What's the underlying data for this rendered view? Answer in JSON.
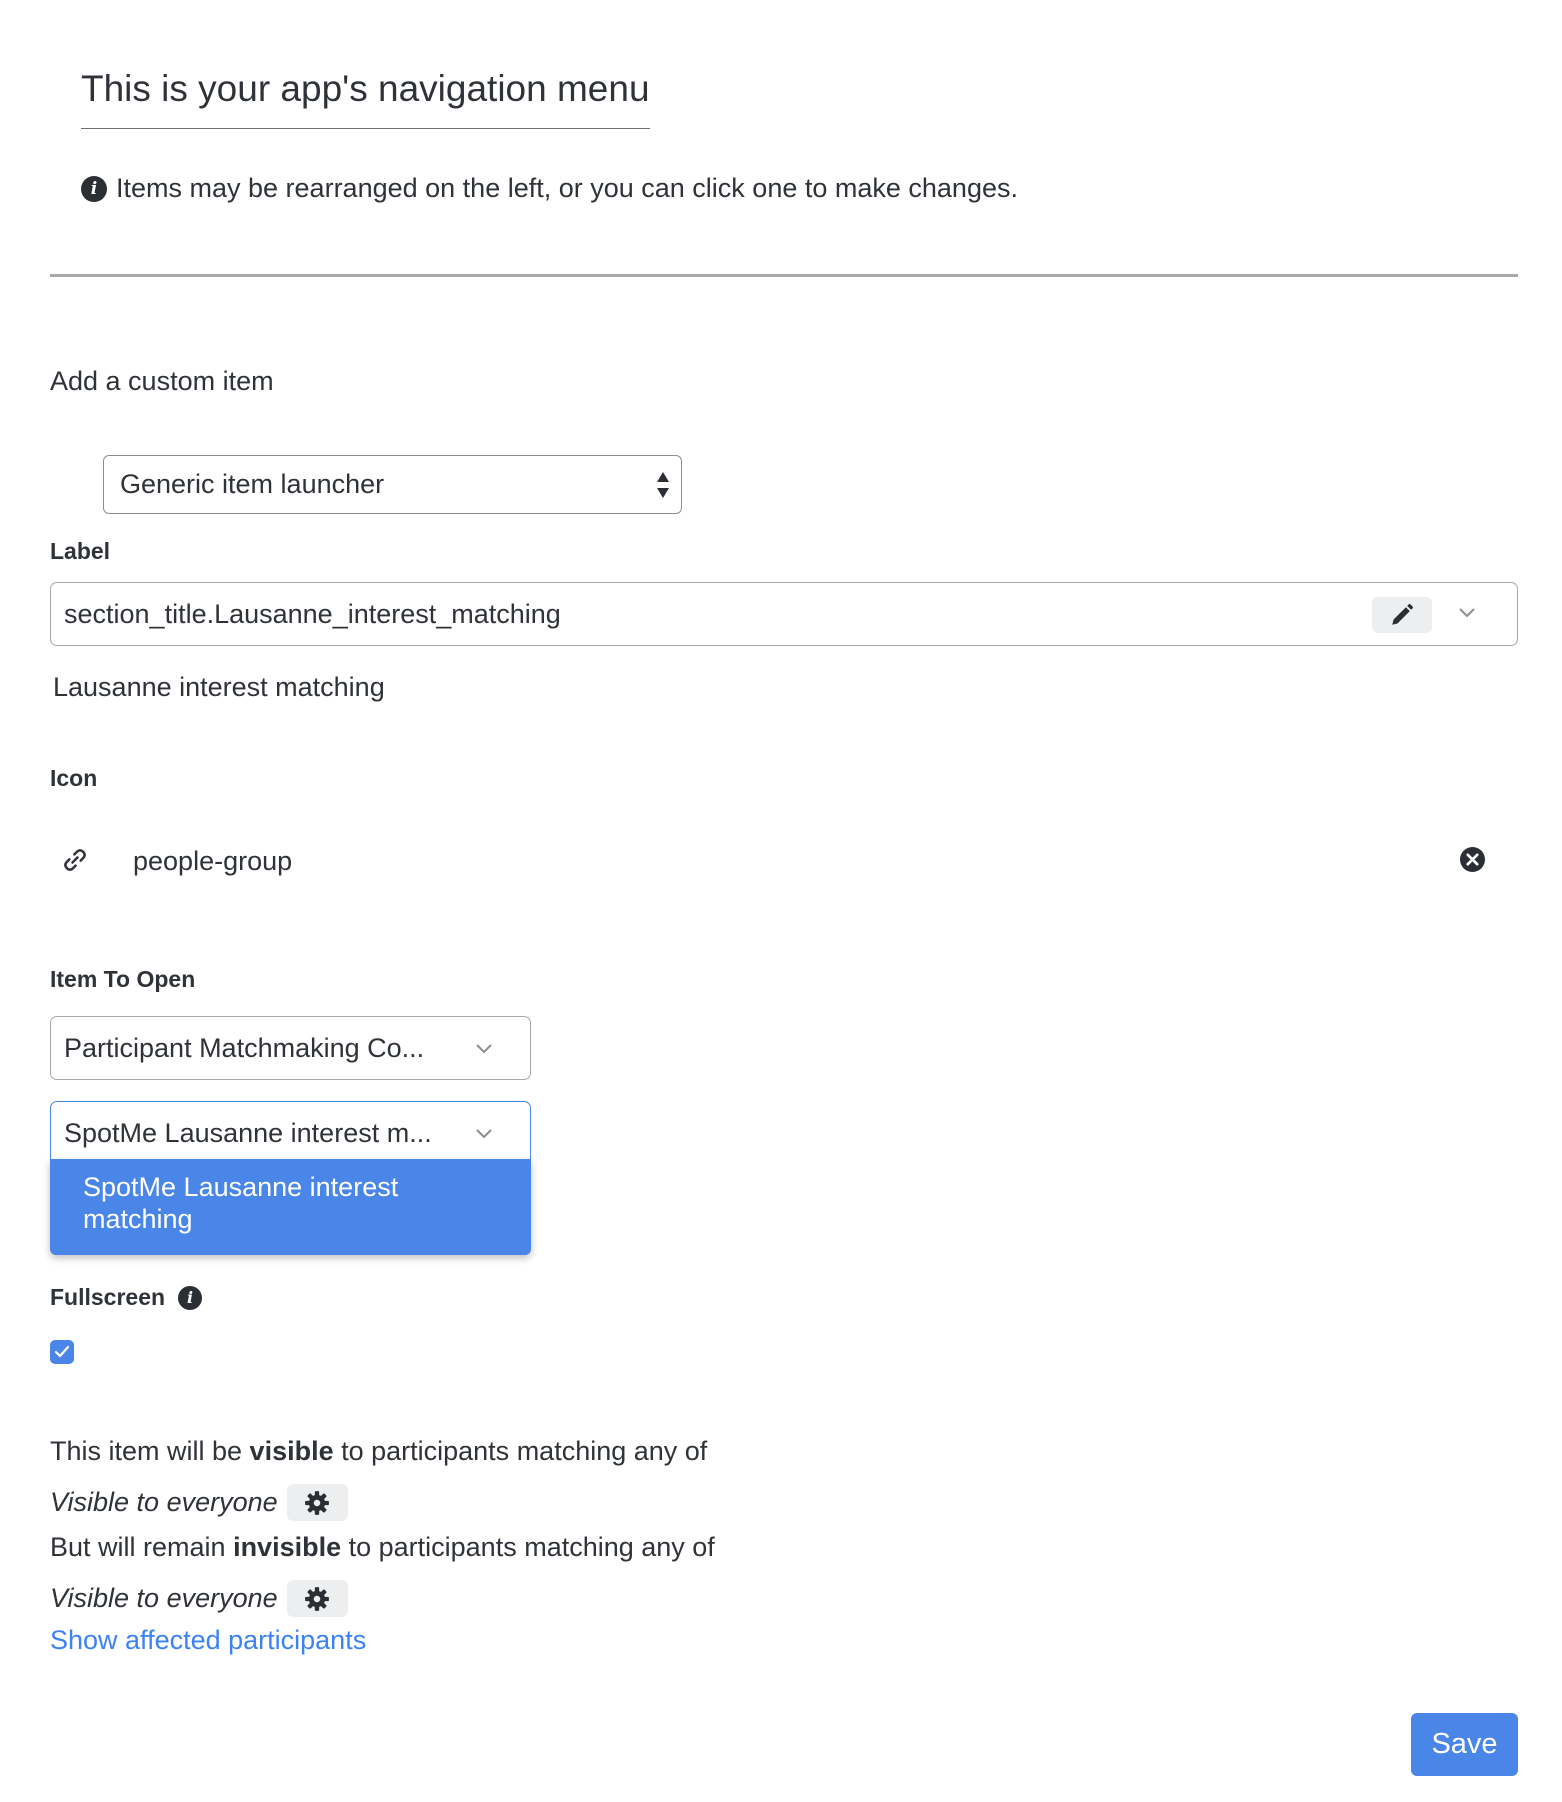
{
  "header": {
    "title": "This is your app's navigation menu",
    "hint": "Items may be rearranged on the left, or you can click one to make changes."
  },
  "custom_item": {
    "section_title": "Add a custom item",
    "type_select": {
      "value": "Generic item launcher"
    }
  },
  "label_field": {
    "label": "Label",
    "value": "section_title.Lausanne_interest_matching",
    "translation": "Lausanne interest matching"
  },
  "icon_field": {
    "label": "Icon",
    "value": "people-group",
    "icon": "link-icon"
  },
  "item_to_open": {
    "label": "Item To Open",
    "type_dropdown": {
      "value": "Participant Matchmaking Co..."
    },
    "item_dropdown": {
      "value": "SpotMe Lausanne interest m...",
      "options": [
        "SpotMe Lausanne interest matching"
      ]
    }
  },
  "fullscreen": {
    "label": "Fullscreen",
    "checked": true
  },
  "visibility": {
    "visible_pre": "This item will be ",
    "visible_bold": "visible",
    "visible_post": " to participants matching any of",
    "visible_rule": "Visible to everyone",
    "invisible_pre": "But will remain ",
    "invisible_bold": "invisible",
    "invisible_post": " to participants matching any of",
    "invisible_rule": "Visible to everyone",
    "affected_link": "Show affected participants"
  },
  "actions": {
    "save_label": "Save"
  },
  "colors": {
    "accent": "#4a86e8",
    "link": "#3b82f6",
    "text": "#2f3338",
    "divider": "#a6a8ab"
  }
}
